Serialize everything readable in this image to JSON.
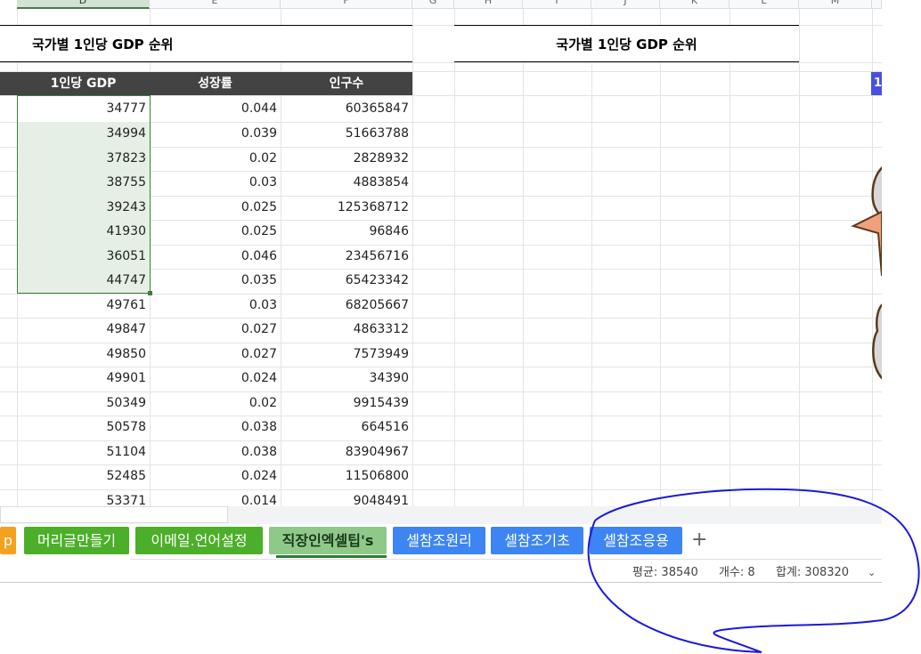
{
  "columns": [
    "D",
    "E",
    "F",
    "G",
    "H",
    "I",
    "J",
    "K",
    "L",
    "M"
  ],
  "left_title": "국가별 1인당 GDP 순위",
  "right_title": "국가별 1인당 GDP 순위",
  "table_headers": [
    "1인당 GDP",
    "성장률",
    "인구수"
  ],
  "rows": [
    {
      "gdp": "34777",
      "growth": "0.044",
      "pop": "60365847"
    },
    {
      "gdp": "34994",
      "growth": "0.039",
      "pop": "51663788"
    },
    {
      "gdp": "37823",
      "growth": "0.02",
      "pop": "2828932"
    },
    {
      "gdp": "38755",
      "growth": "0.03",
      "pop": "4883854"
    },
    {
      "gdp": "39243",
      "growth": "0.025",
      "pop": "125368712"
    },
    {
      "gdp": "41930",
      "growth": "0.025",
      "pop": "96846"
    },
    {
      "gdp": "36051",
      "growth": "0.046",
      "pop": "23456716"
    },
    {
      "gdp": "44747",
      "growth": "0.035",
      "pop": "65423342"
    },
    {
      "gdp": "49761",
      "growth": "0.03",
      "pop": "68205667"
    },
    {
      "gdp": "49847",
      "growth": "0.027",
      "pop": "4863312"
    },
    {
      "gdp": "49850",
      "growth": "0.027",
      "pop": "7573949"
    },
    {
      "gdp": "49901",
      "growth": "0.024",
      "pop": "34390"
    },
    {
      "gdp": "50349",
      "growth": "0.02",
      "pop": "9915439"
    },
    {
      "gdp": "50578",
      "growth": "0.038",
      "pop": "664516"
    },
    {
      "gdp": "51104",
      "growth": "0.038",
      "pop": "83904967"
    },
    {
      "gdp": "52485",
      "growth": "0.024",
      "pop": "11506800"
    },
    {
      "gdp": "53371",
      "growth": "0.014",
      "pop": "9048491"
    }
  ],
  "right_partial_header": "1",
  "tabs": [
    {
      "label": "p",
      "color": "orange"
    },
    {
      "label": "머리글만들기",
      "color": "green"
    },
    {
      "label": "이메일.언어설정",
      "color": "green"
    },
    {
      "label": "직장인엑셀팁's",
      "color": "active"
    },
    {
      "label": "셀참조원리",
      "color": "blue"
    },
    {
      "label": "셀참조기초",
      "color": "blue"
    },
    {
      "label": "셀참조응용",
      "color": "blue"
    }
  ],
  "add_tab_label": "+",
  "status": {
    "average": "평균: 38540",
    "count": "개수: 8",
    "sum": "합계: 308320"
  },
  "colors": {
    "header_bar": "#434343",
    "selection_border": "#3b7f3b",
    "annotation_ink": "#1a1adb"
  }
}
